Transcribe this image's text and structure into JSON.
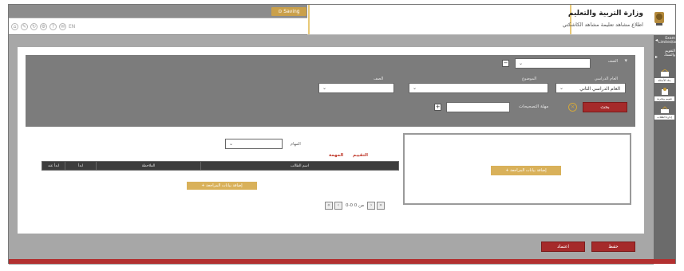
{
  "header": {
    "saving_label": "Saving",
    "ministry_title": "وزارة التربية والتعليم",
    "ministry_subtitle": "اطلاع مشاهد تعليمة مشاهد الكاشكتي",
    "toolbar_text": "EN"
  },
  "sidebar": {
    "title": "Exam Limited/ad",
    "section": "التقويم والتسك",
    "items": [
      {
        "label": "بنك الأسئلة"
      },
      {
        "label": "تقويم وتجربة"
      },
      {
        "label": "إدارة الطلاب"
      }
    ]
  },
  "filters": {
    "term_label": "الصف",
    "type_label": "العام الدراسي",
    "type_value": "العام الدراسي الثاني",
    "subject_label": "الموضوع",
    "level_label": "الصف",
    "duration_label": "مهلة التصحيحات",
    "search_label": "بحث"
  },
  "left_panel": {
    "add_button": "+ إضافة بيانات المراجعة"
  },
  "right_panel": {
    "level_label": "المهام",
    "section_red_1": "التقييم",
    "section_red_2": "المهمة",
    "columns": [
      "اسم الطالب",
      "الملاحظة",
      "ابدأ",
      "ابدأ عند"
    ],
    "add_button": "+ إضافة بيانات المراجعة",
    "pagination_text": "0-0 من 0"
  },
  "footer": {
    "save_label": "حفظ",
    "approve_label": "اعتماد"
  },
  "colors": {
    "accent_red": "#a52a2a",
    "accent_gold": "#d9b15a",
    "header_gray": "#7c7c7c"
  }
}
